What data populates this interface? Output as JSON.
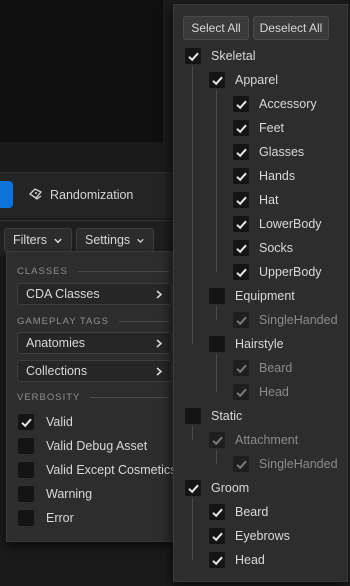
{
  "toolbar": {
    "randomization_label": "Randomization"
  },
  "filterbar": {
    "filters_label": "Filters",
    "settings_label": "Settings"
  },
  "left_menu": {
    "classes_header": "CLASSES",
    "cda_classes": "CDA Classes",
    "gameplay_tags_header": "GAMEPLAY TAGS",
    "anatomies": "Anatomies",
    "collections": "Collections",
    "verbosity_header": "VERBOSITY",
    "verbosity": [
      {
        "label": "Valid",
        "checked": true
      },
      {
        "label": "Valid Debug Asset",
        "checked": false
      },
      {
        "label": "Valid Except Cosmetics",
        "checked": false
      },
      {
        "label": "Warning",
        "checked": false
      },
      {
        "label": "Error",
        "checked": false
      }
    ]
  },
  "right_menu": {
    "select_all": "Select All",
    "deselect_all": "Deselect All",
    "tree": [
      {
        "label": "Skeletal",
        "level": 0,
        "state": "checked"
      },
      {
        "label": "Apparel",
        "level": 1,
        "state": "checked"
      },
      {
        "label": "Accessory",
        "level": 2,
        "state": "checked"
      },
      {
        "label": "Feet",
        "level": 2,
        "state": "checked"
      },
      {
        "label": "Glasses",
        "level": 2,
        "state": "checked"
      },
      {
        "label": "Hands",
        "level": 2,
        "state": "checked"
      },
      {
        "label": "Hat",
        "level": 2,
        "state": "checked"
      },
      {
        "label": "LowerBody",
        "level": 2,
        "state": "checked"
      },
      {
        "label": "Socks",
        "level": 2,
        "state": "checked"
      },
      {
        "label": "UpperBody",
        "level": 2,
        "state": "checked"
      },
      {
        "label": "Equipment",
        "level": 1,
        "state": "unchecked"
      },
      {
        "label": "SingleHanded",
        "level": 2,
        "state": "dim"
      },
      {
        "label": "Hairstyle",
        "level": 1,
        "state": "unchecked"
      },
      {
        "label": "Beard",
        "level": 2,
        "state": "dim"
      },
      {
        "label": "Head",
        "level": 2,
        "state": "dim"
      },
      {
        "label": "Static",
        "level": 0,
        "state": "unchecked"
      },
      {
        "label": "Attachment",
        "level": 1,
        "state": "dim"
      },
      {
        "label": "SingleHanded",
        "level": 2,
        "state": "dim"
      },
      {
        "label": "Groom",
        "level": 0,
        "state": "checked"
      },
      {
        "label": "Beard",
        "level": 1,
        "state": "checked"
      },
      {
        "label": "Eyebrows",
        "level": 1,
        "state": "checked"
      },
      {
        "label": "Head",
        "level": 1,
        "state": "checked"
      }
    ]
  },
  "colors": {
    "accent": "#0b73d9",
    "check": "#e6e6e6",
    "check_dim": "#7a7a7a"
  }
}
